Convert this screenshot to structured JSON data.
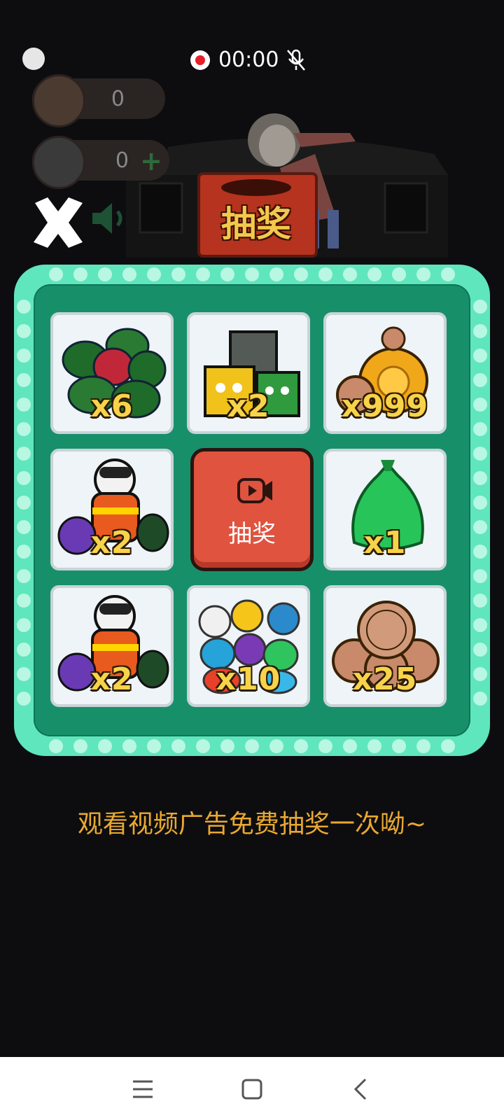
{
  "status": {
    "recording_time": "00:00"
  },
  "resources": {
    "coins": "0",
    "bags": "0"
  },
  "title": "抽奖",
  "grid": [
    {
      "icon": "green-bags-icon",
      "qty": "x6"
    },
    {
      "icon": "cat-boxes-icon",
      "qty": "x2"
    },
    {
      "icon": "coin-bag-icon",
      "qty": "x999"
    },
    {
      "icon": "cleaner-bear-icon",
      "qty": "x2"
    },
    {
      "icon": "green-bag-icon",
      "qty": "x1"
    },
    {
      "icon": "cleaner-bear-icon",
      "qty": "x2"
    },
    {
      "icon": "colorful-bags-icon",
      "qty": "x10"
    },
    {
      "icon": "coins-icon",
      "qty": "x25"
    }
  ],
  "draw_button": {
    "label": "抽奖",
    "icon": "video-play-icon"
  },
  "hint": "观看视频广告免费抽奖一次呦~",
  "nav": {
    "menu": "menu-icon",
    "home": "home-icon",
    "back": "back-icon"
  },
  "colors": {
    "frame": "#5fe6bd",
    "panel": "#17906a",
    "button": "#e0533f",
    "quantity": "#f7d34a",
    "hint": "#e9a830"
  }
}
